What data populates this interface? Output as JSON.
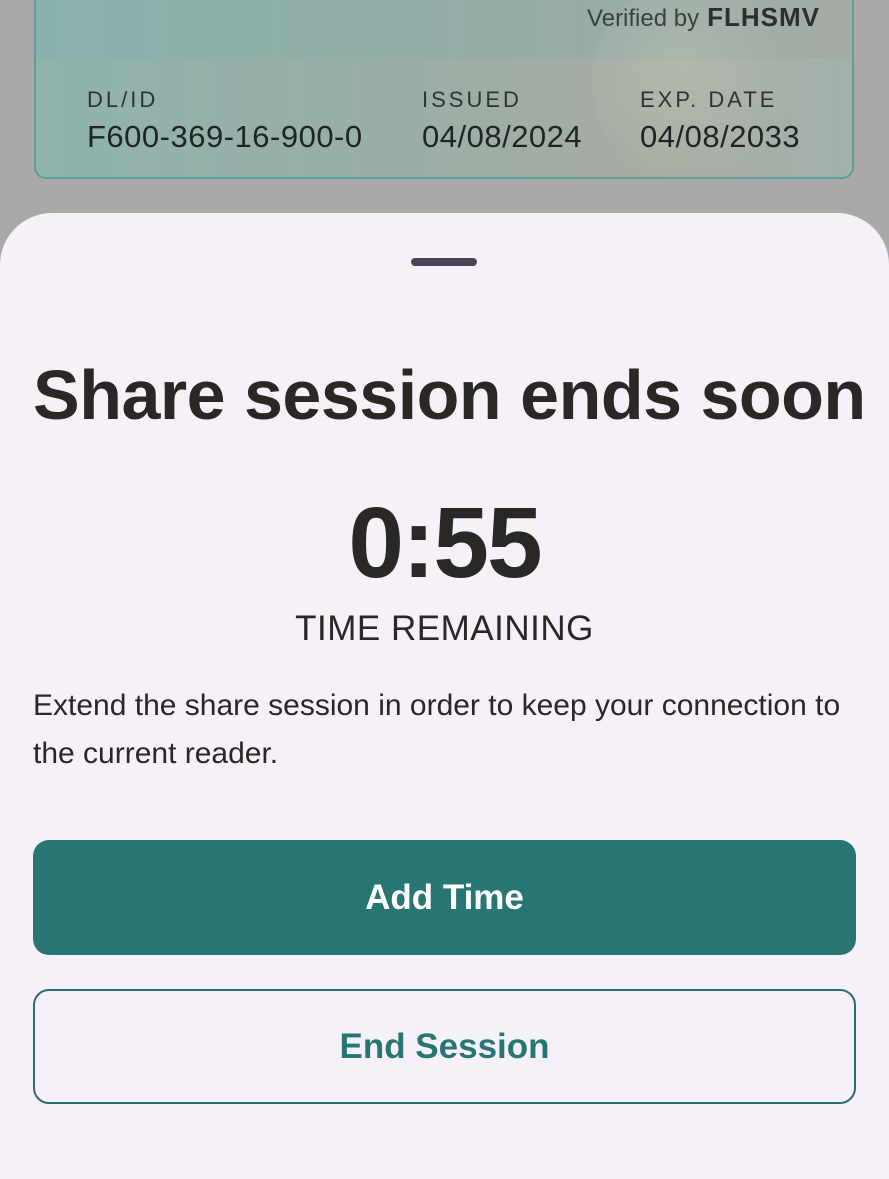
{
  "card": {
    "verified_prefix": "Verified by",
    "verified_logo": "FLHSMV",
    "fields": [
      {
        "label": "DL/ID",
        "value": "F600-369-16-900-0"
      },
      {
        "label": "ISSUED",
        "value": "04/08/2024"
      },
      {
        "label": "EXP. DATE",
        "value": "04/08/2033"
      }
    ]
  },
  "sheet": {
    "title": "Share session ends soon",
    "timer": "0:55",
    "timer_label": "TIME REMAINING",
    "description": "Extend the share session in order to keep your connection to the current reader.",
    "primary_button": "Add Time",
    "secondary_button": "End Session"
  },
  "colors": {
    "accent": "#277673",
    "sheet_background": "#f6f1f9",
    "scrim": "#a9a9a9",
    "text": "#2a2727"
  }
}
